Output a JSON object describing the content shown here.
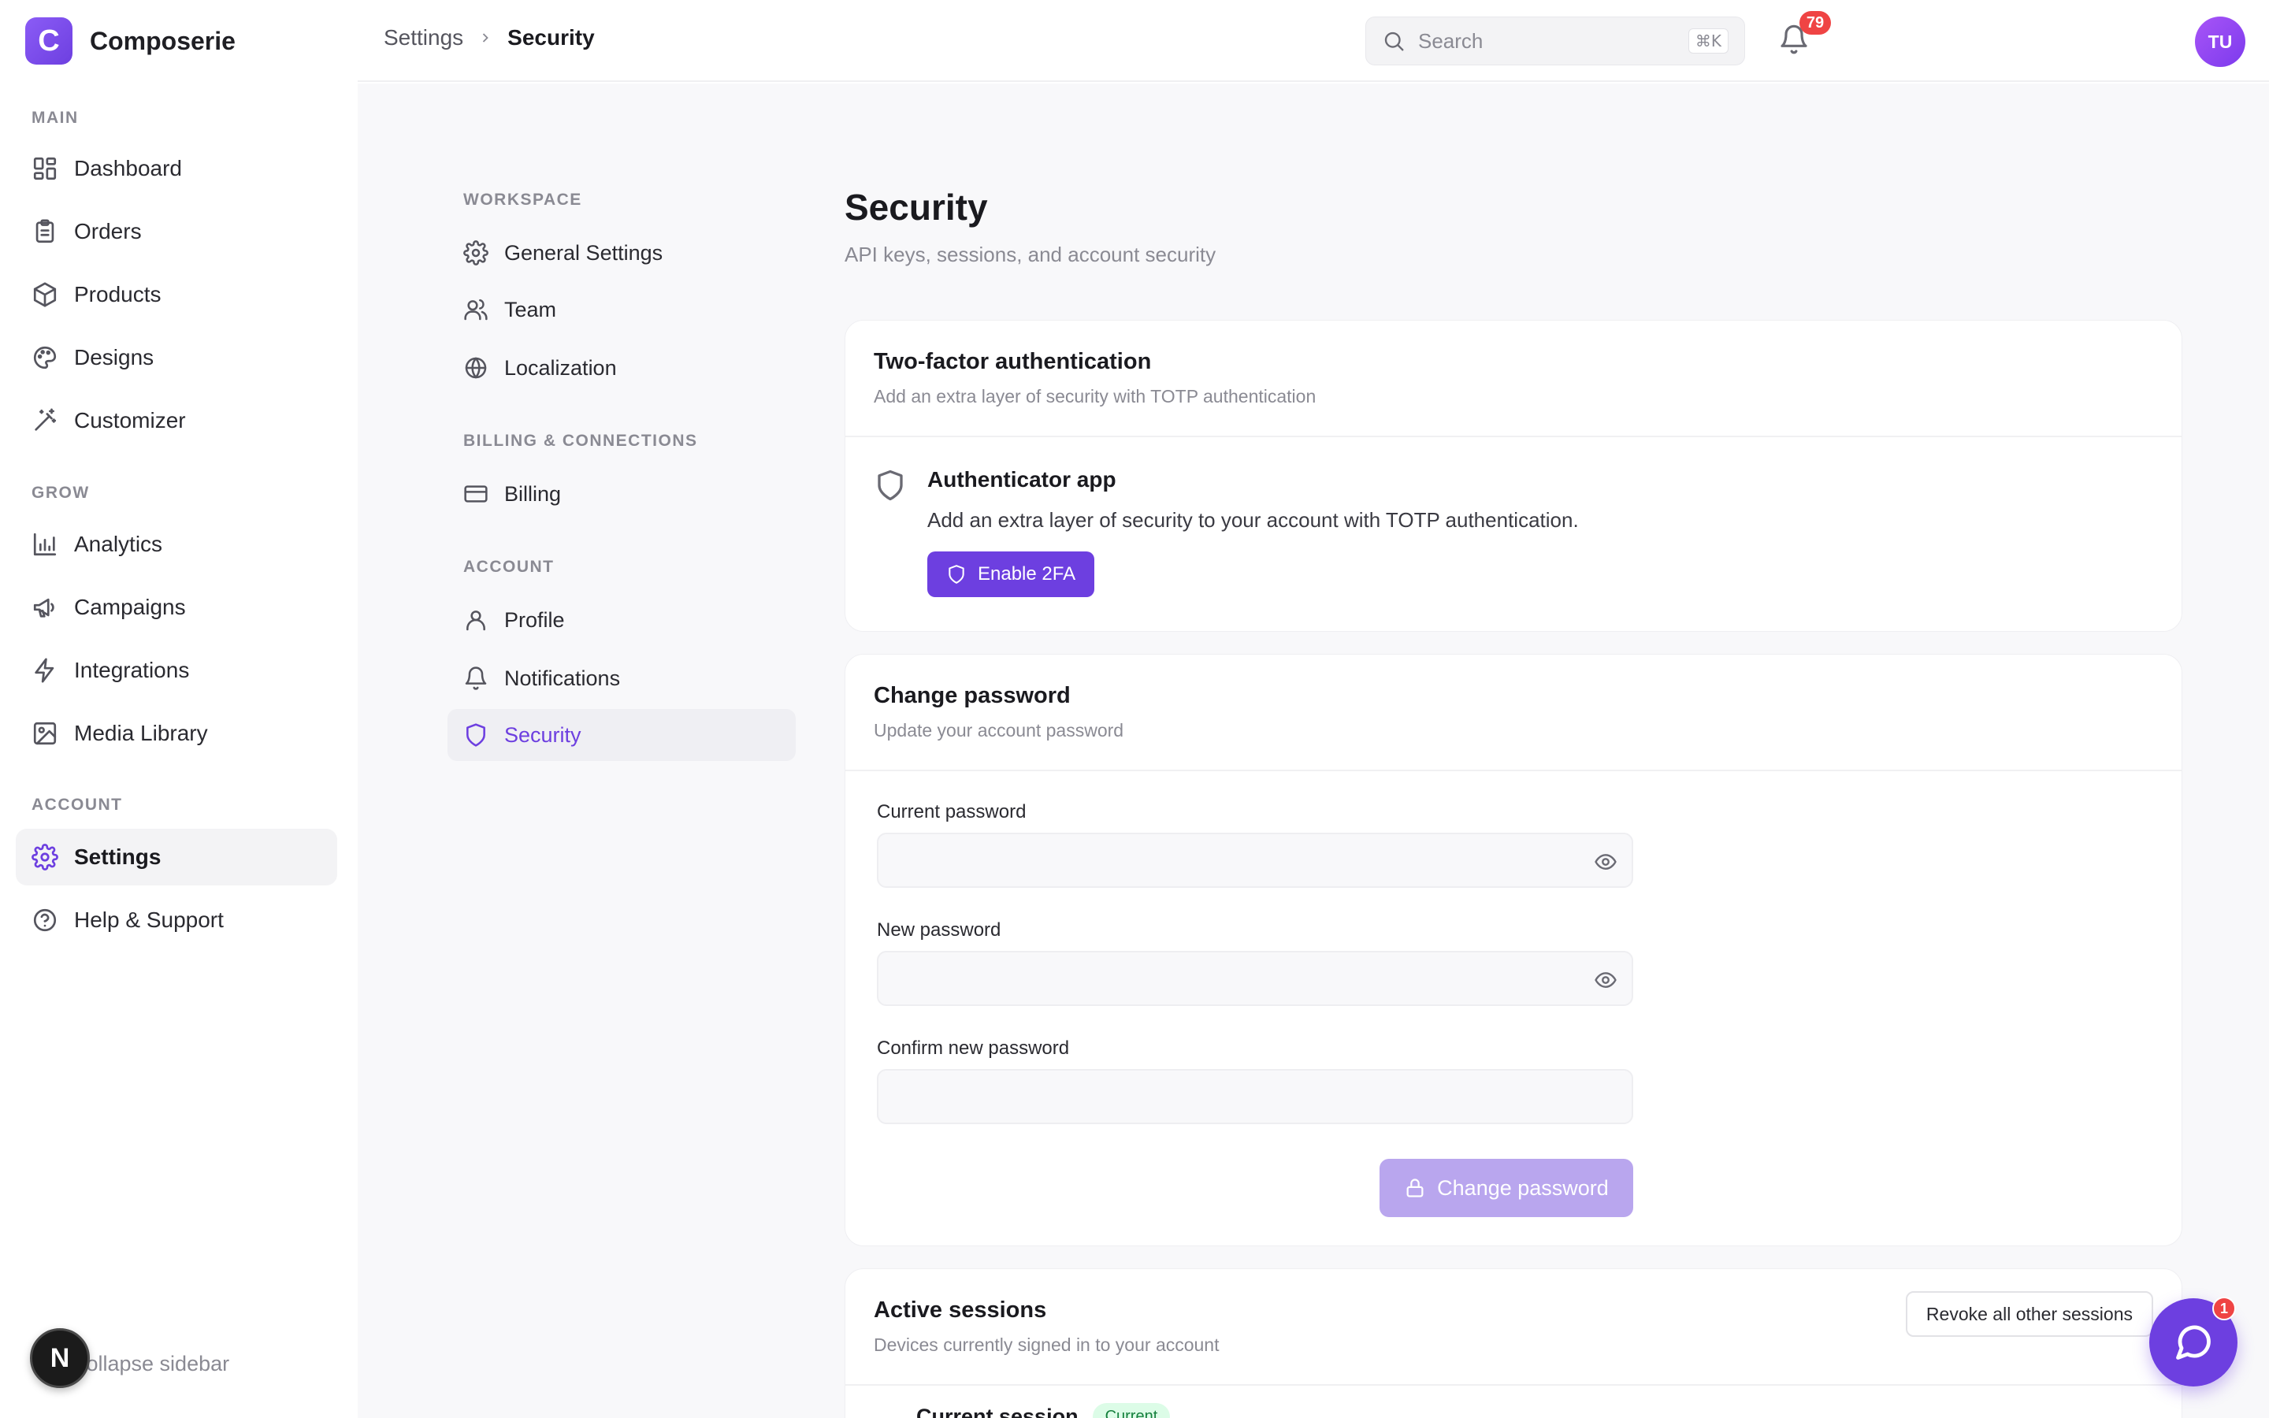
{
  "app": {
    "name": "Composerie",
    "logo_letter": "C"
  },
  "sidebar": {
    "sections": [
      {
        "title": "MAIN"
      },
      {
        "title": "GROW"
      },
      {
        "title": "ACCOUNT"
      }
    ],
    "items": [
      {
        "label": "Dashboard",
        "icon": "dashboard-icon"
      },
      {
        "label": "Orders",
        "icon": "clipboard-icon"
      },
      {
        "label": "Products",
        "icon": "box-icon"
      },
      {
        "label": "Designs",
        "icon": "palette-icon"
      },
      {
        "label": "Customizer",
        "icon": "wand-icon"
      },
      {
        "label": "Analytics",
        "icon": "bar-chart-icon"
      },
      {
        "label": "Campaigns",
        "icon": "megaphone-icon"
      },
      {
        "label": "Integrations",
        "icon": "zap-icon"
      },
      {
        "label": "Media Library",
        "icon": "image-icon"
      },
      {
        "label": "Settings",
        "icon": "gear-icon",
        "active": true
      },
      {
        "label": "Help & Support",
        "icon": "help-circle-icon"
      }
    ],
    "collapse_label": "Collapse sidebar",
    "dev_badge": "N"
  },
  "header": {
    "breadcrumb": {
      "parent": "Settings",
      "current": "Security"
    },
    "search": {
      "placeholder": "Search",
      "shortcut": "⌘K"
    },
    "notifications_count": "79",
    "avatar_initials": "TU"
  },
  "settings_nav": {
    "sections": [
      {
        "title": "WORKSPACE"
      },
      {
        "title": "BILLING & CONNECTIONS"
      },
      {
        "title": "ACCOUNT"
      }
    ],
    "items": [
      {
        "label": "General Settings",
        "icon": "gear-icon"
      },
      {
        "label": "Team",
        "icon": "users-icon"
      },
      {
        "label": "Localization",
        "icon": "globe-icon"
      },
      {
        "label": "Billing",
        "icon": "credit-card-icon"
      },
      {
        "label": "Profile",
        "icon": "user-icon"
      },
      {
        "label": "Notifications",
        "icon": "bell-icon"
      },
      {
        "label": "Security",
        "icon": "shield-icon",
        "active": true
      }
    ]
  },
  "page": {
    "title": "Security",
    "subtitle": "API keys, sessions, and account security"
  },
  "two_factor": {
    "title": "Two-factor authentication",
    "description": "Add an extra layer of security with TOTP authentication",
    "method_title": "Authenticator app",
    "method_text": "Add an extra layer of security to your account with TOTP authentication.",
    "enable_label": "Enable 2FA"
  },
  "change_password": {
    "title": "Change password",
    "description": "Update your account password",
    "current_label": "Current password",
    "current_value": "",
    "new_label": "New password",
    "new_value": "",
    "confirm_label": "Confirm new password",
    "confirm_value": "",
    "submit_label": "Change password"
  },
  "sessions": {
    "title": "Active sessions",
    "description": "Devices currently signed in to your account",
    "revoke_label": "Revoke all other sessions",
    "current_label": "Current session",
    "current_badge": "Current"
  },
  "chat": {
    "unread_count": "1"
  },
  "colors": {
    "accent": "#6d3fe0",
    "badge": "#ef4444",
    "disabled_accent": "#b9a6ee"
  }
}
